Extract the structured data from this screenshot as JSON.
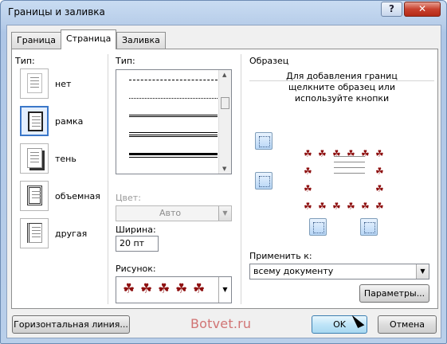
{
  "window": {
    "title": "Границы и заливка",
    "help_label": "?",
    "close_label": "✕"
  },
  "tabs": [
    {
      "label": "Граница"
    },
    {
      "label": "Страница"
    },
    {
      "label": "Заливка"
    }
  ],
  "setting": {
    "label": "Тип:",
    "items": [
      {
        "label": "нет"
      },
      {
        "label": "рамка"
      },
      {
        "label": "тень"
      },
      {
        "label": "объемная"
      },
      {
        "label": "другая"
      }
    ],
    "selected": "рамка"
  },
  "style": {
    "label": "Тип:",
    "line_samples": [
      "dash-dot",
      "dash-dot-dot",
      "double",
      "triple",
      "thick-thin"
    ],
    "scroll_up": "▲",
    "scroll_down": "▼"
  },
  "color": {
    "label": "Цвет:",
    "value": "Авто",
    "dropdown": "▼"
  },
  "width": {
    "label": "Ширина:",
    "value": "20 пт"
  },
  "art": {
    "label": "Рисунок:",
    "glyph": "☘",
    "dropdown": "▼"
  },
  "preview": {
    "label": "Образец",
    "instructions": "Для добавления границ щелкните образец или используйте кнопки",
    "glyph": "☘"
  },
  "apply": {
    "label": "Применить к:",
    "value": "всему документу",
    "dropdown": "▼",
    "options_button": "Параметры..."
  },
  "footer": {
    "horizontal_line_button": "Горизонтальная линия...",
    "ok_button": "OK",
    "cancel_button": "Отмена",
    "watermark": "Botvet.ru"
  },
  "colors": {
    "accent": "#3b77c9",
    "art_red": "#8e1010"
  }
}
